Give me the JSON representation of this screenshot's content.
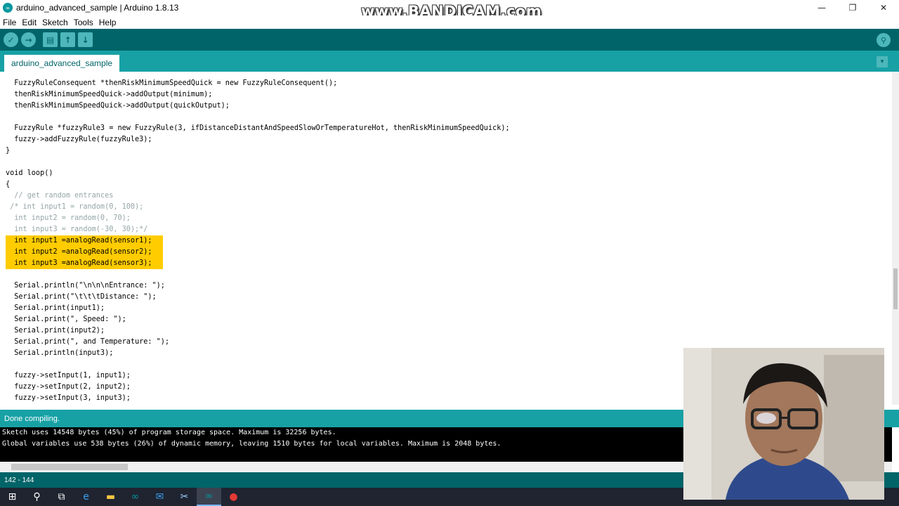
{
  "window": {
    "title": "arduino_advanced_sample | Arduino 1.8.13",
    "minimize": "—",
    "maximize": "❐",
    "close": "✕"
  },
  "watermark": "www.BANDICAM.com",
  "menu": [
    "File",
    "Edit",
    "Sketch",
    "Tools",
    "Help"
  ],
  "toolbar": {
    "verify": "✓",
    "upload": "→",
    "new": "▤",
    "open": "↑",
    "save": "↓",
    "serial_monitor": "⚲"
  },
  "tab": {
    "label": "arduino_advanced_sample",
    "menu_icon": "▾"
  },
  "code_lines": [
    "  FuzzyRuleConsequent *thenRiskMinimumSpeedQuick = new FuzzyRuleConsequent();",
    "  thenRiskMinimumSpeedQuick->addOutput(minimum);",
    "  thenRiskMinimumSpeedQuick->addOutput(quickOutput);",
    "",
    "  FuzzyRule *fuzzyRule3 = new FuzzyRule(3, ifDistanceDistantAndSpeedSlowOrTemperatureHot, thenRiskMinimumSpeedQuick);",
    "  fuzzy->addFuzzyRule(fuzzyRule3);",
    "}",
    "",
    "void loop()",
    "{",
    "  // get random entrances",
    " /* int input1 = random(0, 100);",
    "  int input2 = random(0, 70);",
    "  int input3 = random(-30, 30);*/",
    "  int input1 =analogRead(sensor1);",
    "  int input2 =analogRead(sensor2);",
    "  int input3 =analogRead(sensor3);",
    "",
    "  Serial.println(\"\\n\\n\\nEntrance: \");",
    "  Serial.print(\"\\t\\t\\tDistance: \");",
    "  Serial.print(input1);",
    "  Serial.print(\", Speed: \");",
    "  Serial.print(input2);",
    "  Serial.print(\", and Temperature: \");",
    "  Serial.println(input3);",
    "",
    "  fuzzy->setInput(1, input1);",
    "  fuzzy->setInput(2, input2);",
    "  fuzzy->setInput(3, input3);"
  ],
  "status_message": "Done compiling.",
  "console_lines": [
    "Sketch uses 14548 bytes (45%) of program storage space. Maximum is 32256 bytes.",
    "Global variables use 538 bytes (26%) of dynamic memory, leaving 1510 bytes for local variables. Maximum is 2048 bytes."
  ],
  "footer": {
    "line_range": "142 - 144"
  },
  "taskbar": {
    "icons": [
      "windows-start",
      "search",
      "task-view",
      "edge",
      "file-explorer",
      "arduino",
      "mail",
      "snipping-tool",
      "arduino-active",
      "bandicam-record"
    ],
    "glyphs": [
      "⊞",
      "⚲",
      "⧉",
      "e",
      "▬",
      "∞",
      "✉",
      "✂",
      "∞",
      "●"
    ]
  }
}
